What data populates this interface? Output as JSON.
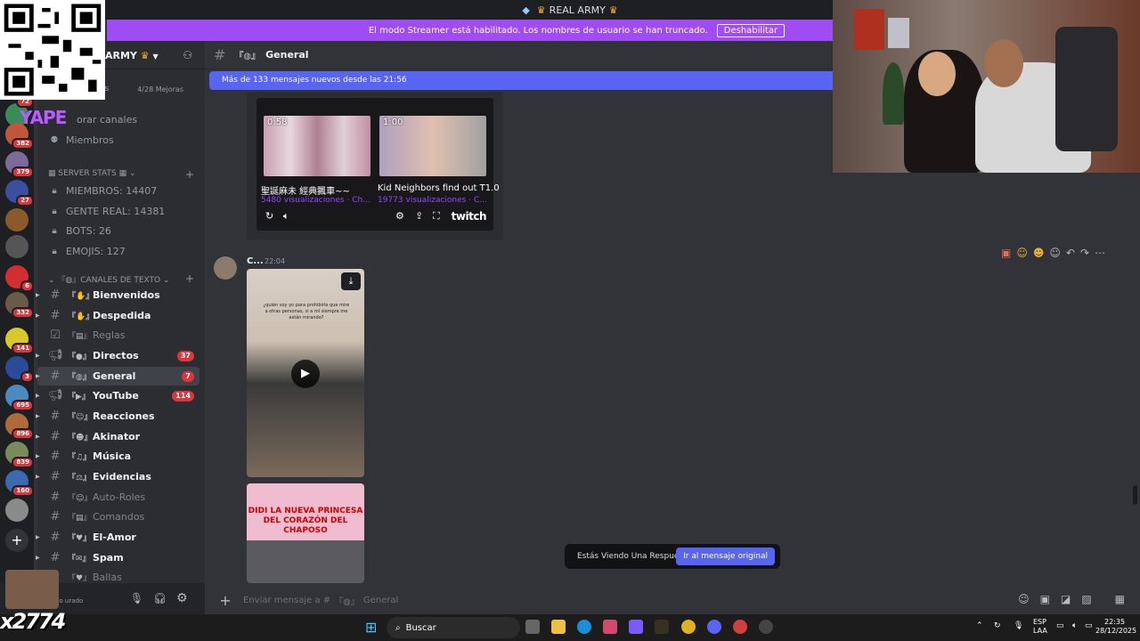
{
  "titlebar": {
    "title": "REAL ARMY"
  },
  "streamer_banner": {
    "text": "El modo Streamer está habilitado. Los nombres de usuario se han truncado.",
    "button": "Deshabilitar"
  },
  "overlay": {
    "yape_text": "YAPE",
    "count_text": "x2774"
  },
  "server": {
    "name_fragment": "ARMY",
    "boost_fragment": "as",
    "boost_count": "4/28 Mejoras",
    "explore_channels": "orar canales",
    "members_label": "Miembros"
  },
  "guild_badges": [
    "72",
    "382",
    "379",
    "27",
    "6",
    "332",
    "141",
    "3",
    "695",
    "896",
    "839",
    "160"
  ],
  "server_stats": {
    "category": "SERVER STATS",
    "items": [
      "MIEMBROS: 14407",
      "GENTE REAL: 14381",
      "BOTS: 26",
      "EMOJIS: 127"
    ]
  },
  "text_channels": {
    "category": "CANALES DE TEXTO",
    "items": [
      {
        "name": "Bienvenidos",
        "badge": ""
      },
      {
        "name": "Despedida",
        "badge": ""
      },
      {
        "name": "Reglas",
        "badge": ""
      },
      {
        "name": "Directos",
        "badge": "37"
      },
      {
        "name": "General",
        "badge": "7"
      },
      {
        "name": "YouTube",
        "badge": "114"
      },
      {
        "name": "Reacciones",
        "badge": ""
      },
      {
        "name": "Akinator",
        "badge": ""
      },
      {
        "name": "Música",
        "badge": ""
      },
      {
        "name": "Evidencias",
        "badge": ""
      },
      {
        "name": "Auto-Roles",
        "badge": ""
      },
      {
        "name": "Comandos",
        "badge": ""
      },
      {
        "name": "El-Amor",
        "badge": ""
      },
      {
        "name": "Spam",
        "badge": ""
      },
      {
        "name": "Ballas",
        "badge": ""
      }
    ]
  },
  "user_panel": {
    "status": "ulo urado"
  },
  "chat": {
    "channel_name": "General",
    "new_messages_bar": "Más de 133 mensajes nuevos desde las 21:56",
    "twitch": {
      "clip1_duration": "0:58",
      "clip1_title": "聖誕麻未 經典飄車~~",
      "clip1_views": "5480 visualizaciones · Ch...",
      "clip2_duration": "1:00",
      "clip2_title": "Kid Neighbors find out T1.0",
      "clip2_views": "19773 visualizaciones · C...",
      "logo": "twitch"
    },
    "message": {
      "author": "C...",
      "time": "22:04",
      "video1_caption": "¿quién soy yo para prohibirle que mire a otras personas, si a mí siempre me están mirando?",
      "video2_caption": "DIDI LA NUEVA PRINCESA DEL CORAZÓN DEL CHAPOSO"
    },
    "reply_toast": {
      "text": "Estás Viendo Una Respuesta.",
      "button": "Ir al mensaje original"
    },
    "composer_placeholder": "Enviar mensaje a #",
    "composer_channel": "General"
  },
  "taskbar": {
    "search_label": "Buscar",
    "lang_top": "ESP",
    "lang_bottom": "LAA",
    "clock_time": "22:35",
    "clock_date": "28/12/2025"
  },
  "colors": {
    "accent": "#5865f2",
    "streamer_banner": "#a04cf5",
    "badge": "#da373c",
    "twitch": "#9147ff"
  }
}
